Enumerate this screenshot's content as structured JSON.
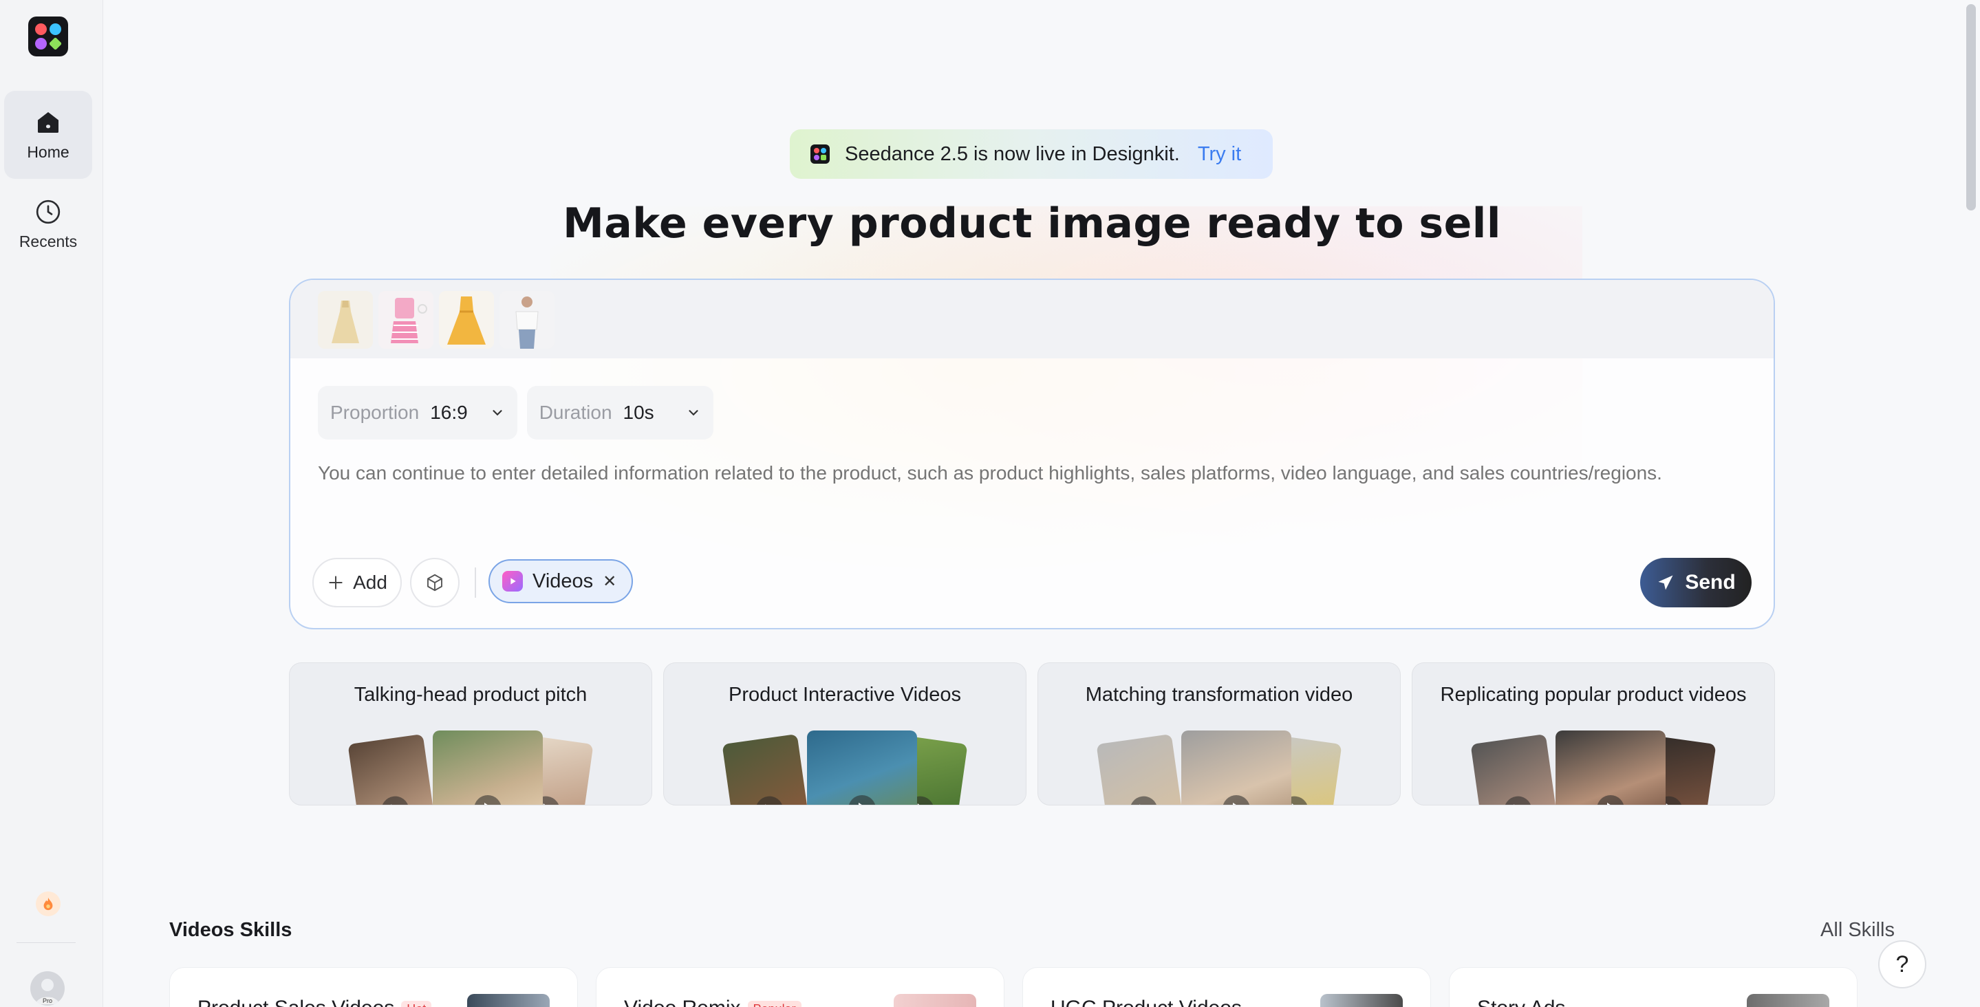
{
  "sidebar": {
    "items": [
      {
        "label": "Home",
        "icon": "home-icon",
        "active": true
      },
      {
        "label": "Recents",
        "icon": "clock-icon",
        "active": false
      }
    ],
    "avatar_badge": "Pro"
  },
  "announcement": {
    "text": "Seedance 2.5 is now live in Designkit.",
    "link": "Try it"
  },
  "headline": "Make every product image ready to sell",
  "composer": {
    "proportion_label": "Proportion",
    "proportion_value": "16:9",
    "duration_label": "Duration",
    "duration_value": "10s",
    "placeholder": "You can continue to enter detailed information related to the product, such as product highlights, sales platforms, video language, and sales countries/regions.",
    "add_label": "Add",
    "chip_label": "Videos",
    "send_label": "Send"
  },
  "templates": [
    {
      "title": "Talking-head product pitch"
    },
    {
      "title": "Product Interactive Videos"
    },
    {
      "title": "Matching transformation video"
    },
    {
      "title": "Replicating popular product videos"
    }
  ],
  "skills_section": {
    "title": "Videos Skills",
    "all_link": "All Skills",
    "items": [
      {
        "name": "Product Sales Videos",
        "badge": "Hot"
      },
      {
        "name": "Video Remix",
        "badge": "Popular"
      },
      {
        "name": "UGC Product Videos",
        "badge": ""
      },
      {
        "name": "Story Ads",
        "badge": ""
      }
    ]
  },
  "help_label": "?",
  "colors": {
    "accent": "#3b7cf0",
    "composer_border": "#b9d0f2",
    "chip_border": "#7aa4e6",
    "badge_red": "#e0393e"
  }
}
